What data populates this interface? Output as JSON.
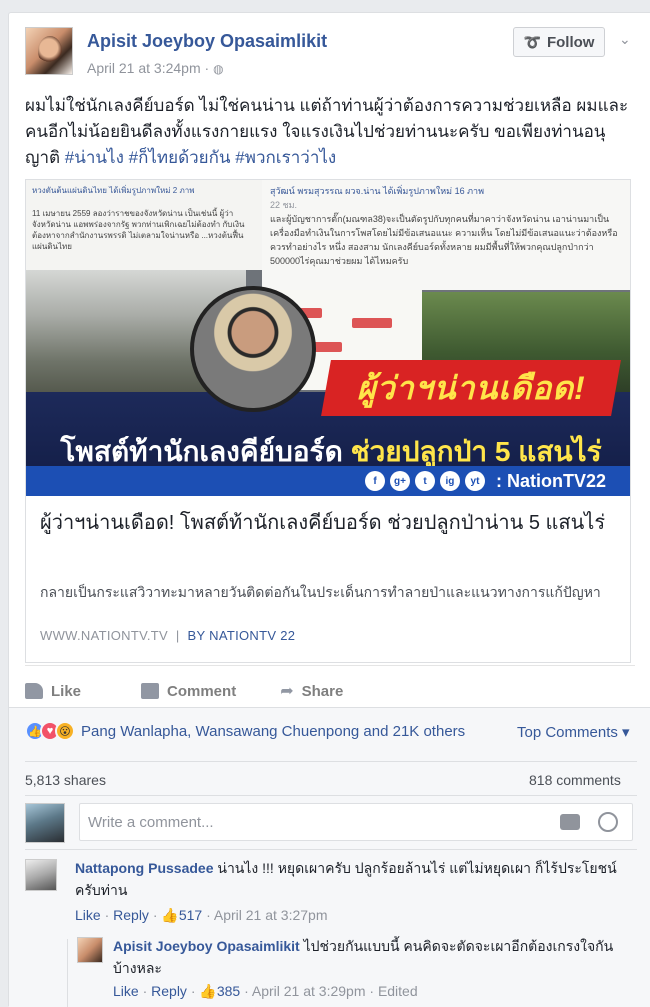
{
  "post": {
    "author": "Apisit Joeyboy Opasaimlikit",
    "time": "April 21 at 3:24pm · ",
    "globe_icon": "globe-icon",
    "follow_label": "Follow",
    "text_main": "ผมไม่ใช่นักเลงคีย์บอร์ด ไม่ใช่คนน่าน แต่ถ้าท่านผู้ว่าต้องการความช่วยเหลือ ผมและคนอีกไม่น้อยยินดีลงทั้งแรงกายแรง ใจแรงเงินไปช่วยท่านนะครับ ขอเพียงท่านอนุญาติ ",
    "hashtags": [
      "#น่านไง",
      "#ก็ไทยด้วยกัน",
      "#พวกเราว่าไง"
    ]
  },
  "link": {
    "image": {
      "left_header": "หวงตันต้นแผ่นดินไทย ได้เพิ่มรูปภาพใหม่ 2 ภาพ",
      "left_text": "11 เมษายน 2559 ลองว่าราชของจังหวัดน่าน เป็นเช่นนี้ ผู้ว่าจังหวัดน่าน แอพพร่องจากรัฐ พวกท่านเพิกเฉยไม่ต้องทำ กับเงินต้องหาจากสำนักงานรพรรดิ ไม่เตลามใจน่านหรือ ...หวงต้นฟื้นแผ่นดินไทย",
      "right_header": "สุวัฒน์ พรมสุวรรณ ผวจ.น่าน ได้เพิ่มรูปภาพใหม่ 16 ภาพ",
      "right_time": "22 ชม.",
      "right_text": "และผู้บัญชาการตั๊ก(มณฑล38)จะเป็นตัดรูปกับทุกคนที่มาคาว่าจังหวัดน่าน เอาน่านมาเป็นเครื่องมือทำเงินในการโพสโดยไม่มีข้อเสนอแนะ ความเห็น โดยไม่มีข้อเสนอแนะว่าต้องหรือควรทำอย่างไร หนึ่ง สองสาม นักเลงคีย์บอร์ดทั้งหลาย ผมมีพื้นที่ให้พวกคุณปลูกป่ากว่า 500000ไร่คุณมาช่วยผม ได้ไหมครับ",
      "headline_red": "ผู้ว่าฯน่านเดือด!",
      "headline_white": "โพสต์ท้านักเลงคีย์บอร์ด ",
      "headline_yellow": "ช่วยปลูกป่า 5 แสนไร่",
      "social_icons": [
        "f",
        "g+",
        "t",
        "ig",
        "yt"
      ],
      "brand": ": NationTV22"
    },
    "title": "ผู้ว่าฯน่านเดือด! โพสต์ท้านักเลงคีย์บอร์ด ช่วยปลูกป่าน่าน 5 แสนไร่",
    "description": "กลายเป็นกระแสวิวาทะมาหลายวันติดต่อกันในประเด็นการทำลายป่าและแนวทางการแก้ปัญหา",
    "source": "WWW.NATIONTV.TV",
    "separator": "|",
    "by": "BY NATIONTV 22"
  },
  "actions": {
    "like": "Like",
    "comment": "Comment",
    "share": "Share"
  },
  "stats": {
    "reactions_text": "Pang Wanlapha, Wansawang Chuenpong and 21K others",
    "top_comments": "Top Comments ▾",
    "shares": "5,813 shares",
    "comments": "818 comments"
  },
  "composer": {
    "placeholder": "Write a comment..."
  },
  "comments": [
    {
      "author": "Nattapong Pussadee",
      "text": " น่านไง !!! หยุดเผาครับ ปลูกร้อยล้านไร่ แต่ไม่หยุดเผา ก็ไร้ประโยชน์ครับท่าน",
      "like": "Like",
      "reply": "Reply",
      "likes": "517",
      "time": "April 21 at 3:27pm"
    },
    {
      "author": "Apisit Joeyboy Opasaimlikit",
      "text": " ไปช่วยกันแบบนี้ คนคิดจะตัดจะเผาอีกต้องเกรงใจกันบ้างหละ",
      "like": "Like",
      "reply": "Reply",
      "likes": "385",
      "time": "April 21 at 3:29pm",
      "edited": "Edited"
    }
  ],
  "meta_sep": " · "
}
